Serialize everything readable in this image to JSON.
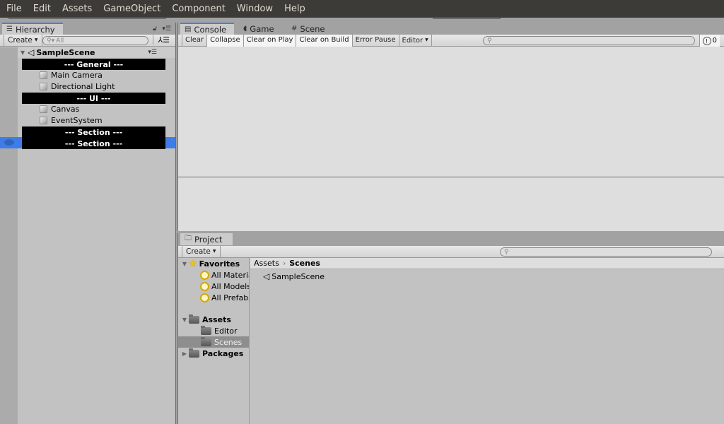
{
  "menubar": {
    "items": [
      "File",
      "Edit",
      "Assets",
      "GameObject",
      "Component",
      "Window",
      "Help"
    ]
  },
  "hierarchy": {
    "tab_label": "Hierarchy",
    "create_label": "Create",
    "search_placeholder": "All",
    "scene_name": "SampleScene",
    "rows": [
      {
        "type": "header",
        "label": "--- General ---"
      },
      {
        "type": "object",
        "label": "Main Camera"
      },
      {
        "type": "object",
        "label": "Directional Light"
      },
      {
        "type": "header",
        "label": "--- UI ---"
      },
      {
        "type": "object",
        "label": "Canvas"
      },
      {
        "type": "object",
        "label": "EventSystem"
      },
      {
        "type": "header",
        "label": "--- Section ---"
      },
      {
        "type": "header",
        "label": "--- Section ---",
        "selected": true
      }
    ]
  },
  "console": {
    "tabs": [
      {
        "label": "Console",
        "icon": "console-icon",
        "active": true
      },
      {
        "label": "Game",
        "icon": "game-icon",
        "active": false
      },
      {
        "label": "Scene",
        "icon": "scene-grid-icon",
        "active": false
      }
    ],
    "buttons": [
      {
        "label": "Clear",
        "on": false
      },
      {
        "label": "Collapse",
        "on": true
      },
      {
        "label": "Clear on Play",
        "on": true
      },
      {
        "label": "Clear on Build",
        "on": true
      },
      {
        "label": "Error Pause",
        "on": false
      },
      {
        "label": "Editor",
        "on": false,
        "dropdown": true
      }
    ],
    "search_value": "",
    "error_count": "0"
  },
  "project": {
    "tab_label": "Project",
    "create_label": "Create",
    "search_value": "",
    "tree": {
      "favorites_label": "Favorites",
      "favorites": [
        "All Materials",
        "All Models",
        "All Prefabs"
      ],
      "assets_label": "Assets",
      "assets_children": [
        "Editor",
        "Scenes"
      ],
      "selected": "Scenes",
      "packages_label": "Packages"
    },
    "breadcrumb": [
      "Assets",
      "Scenes"
    ],
    "files": [
      {
        "name": "SampleScene",
        "icon": "unity-scene-icon"
      }
    ]
  }
}
